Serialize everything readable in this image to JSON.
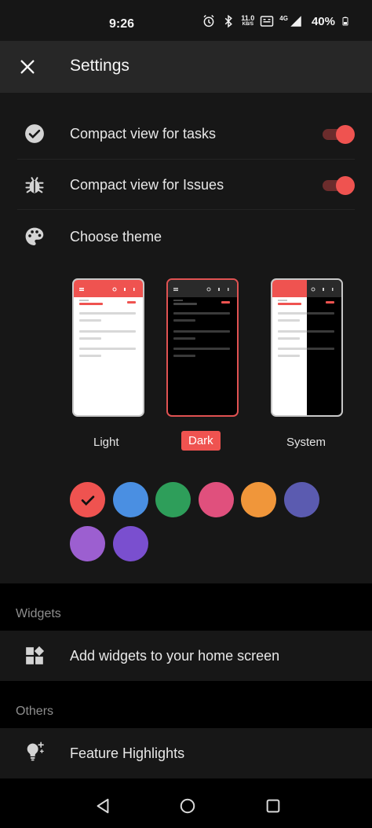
{
  "status_bar": {
    "time": "9:26",
    "speed_value": "11.0",
    "speed_unit": "KB/S",
    "network": "4G",
    "battery": "40%"
  },
  "app_bar": {
    "title": "Settings"
  },
  "settings": {
    "compact_tasks": {
      "label": "Compact view for tasks",
      "enabled": true
    },
    "compact_issues": {
      "label": "Compact view for Issues",
      "enabled": true
    },
    "choose_theme": {
      "label": "Choose theme"
    }
  },
  "themes": [
    {
      "label": "Light",
      "selected": false
    },
    {
      "label": "Dark",
      "selected": true
    },
    {
      "label": "System",
      "selected": false
    }
  ],
  "accent_colors": [
    "#ef5350",
    "#4a8fe2",
    "#2e9e5a",
    "#e0507d",
    "#f0963a",
    "#5b5bb0",
    "#9c5fd0",
    "#7a4fcf"
  ],
  "selected_accent": "#ef5350",
  "sections": {
    "widgets": {
      "header": "Widgets",
      "item_label": "Add widgets to your home screen"
    },
    "others": {
      "header": "Others",
      "item_label": "Feature Highlights"
    }
  },
  "icons": {
    "close": "close-icon",
    "compact_tasks": "check-circle-icon",
    "compact_issues": "bug-icon",
    "choose_theme": "palette-icon",
    "widgets": "widgets-icon",
    "feature_highlights": "lightbulb-icon"
  }
}
